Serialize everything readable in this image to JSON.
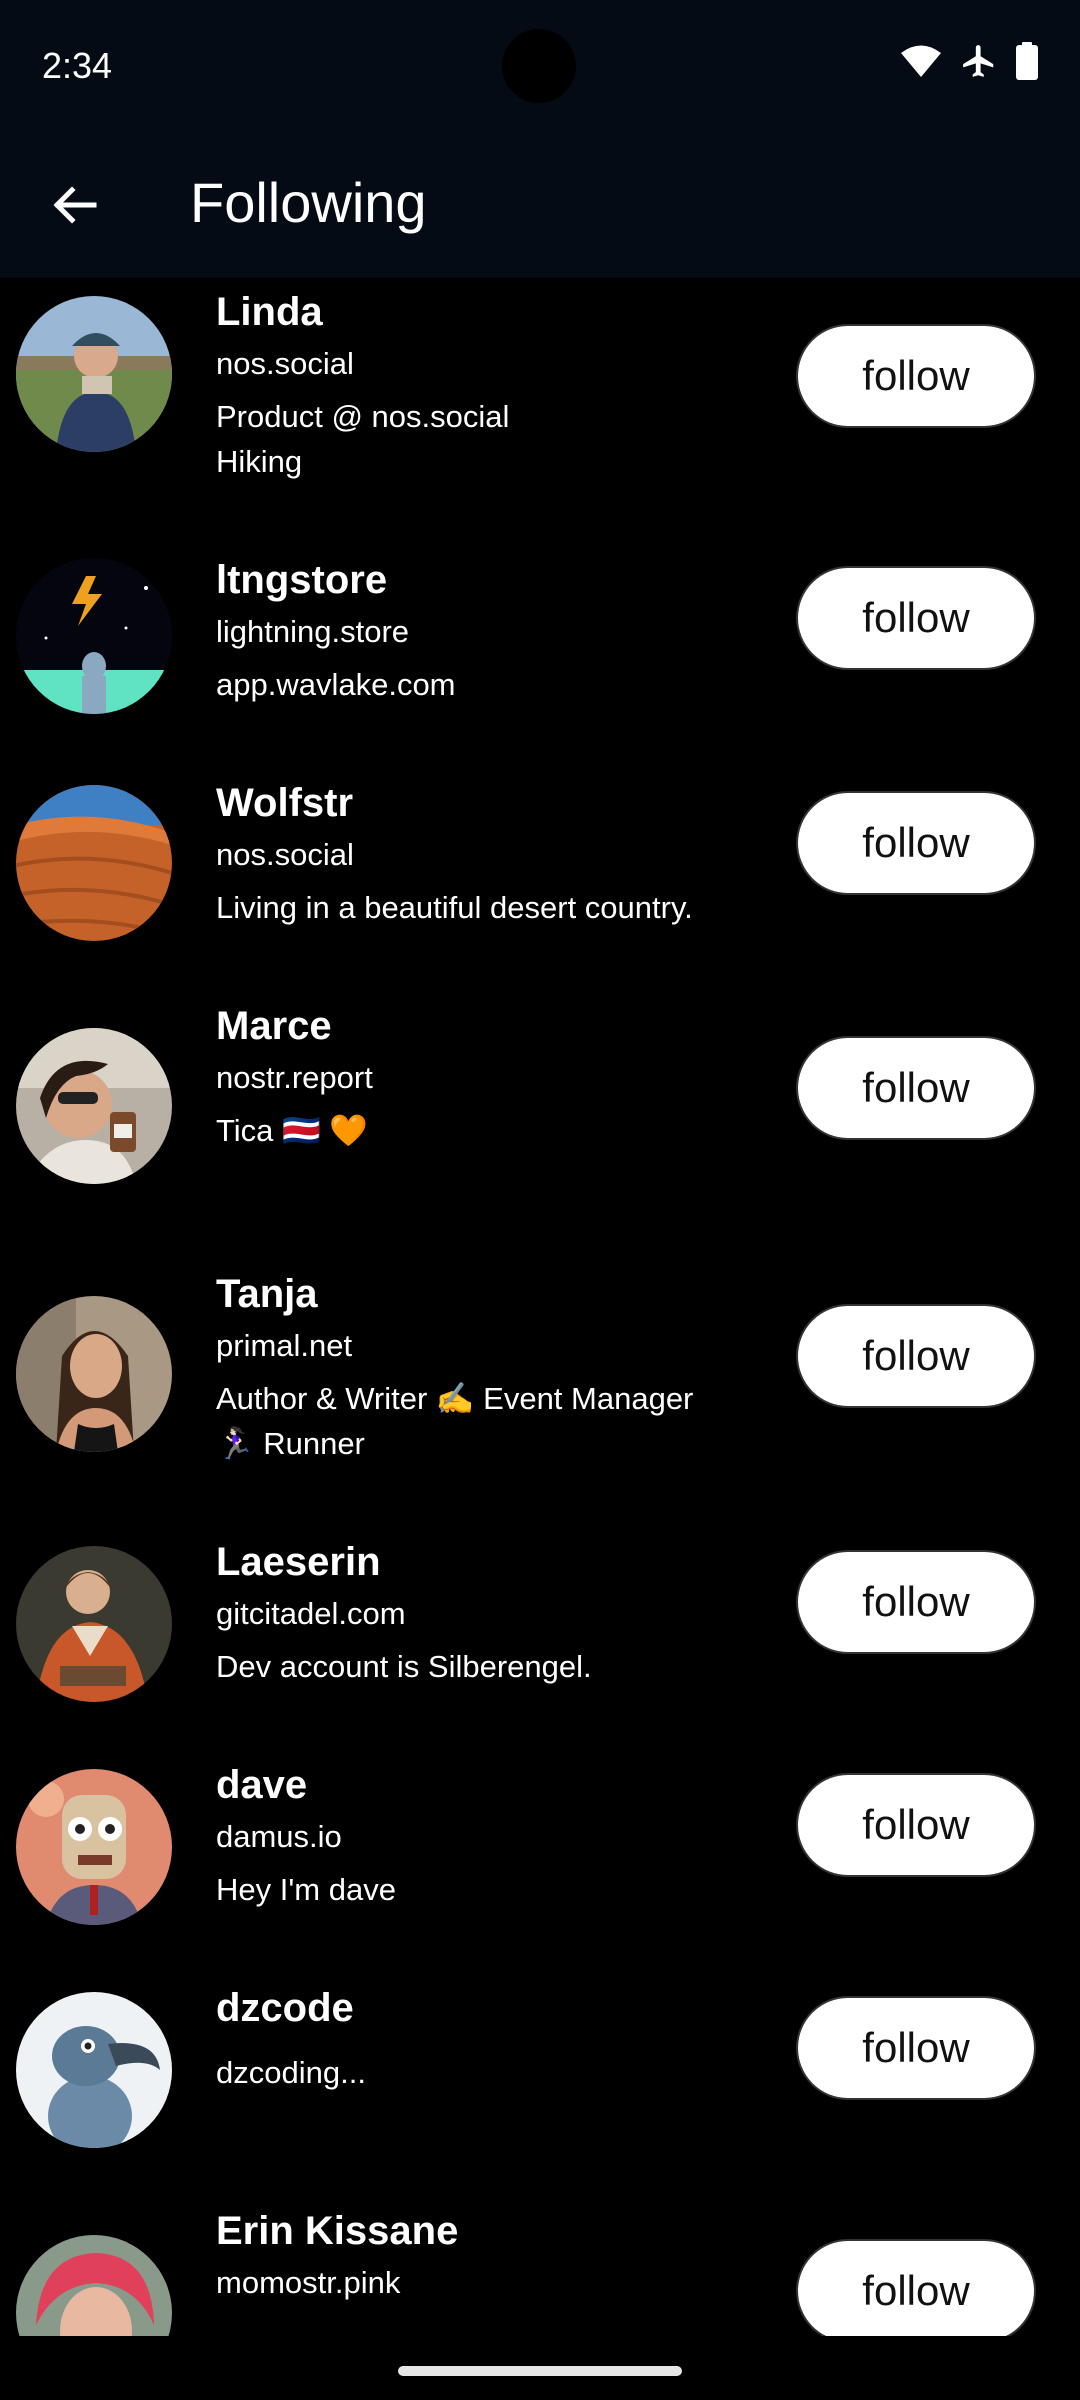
{
  "status_bar": {
    "time": "2:34",
    "icons": [
      "wifi-icon",
      "airplane-icon",
      "battery-icon"
    ]
  },
  "app_bar": {
    "title": "Following",
    "back_icon": "arrow-left-icon"
  },
  "follow_label": "follow",
  "colors": {
    "background": "#000000",
    "header": "#050b14",
    "button_bg": "#ffffff",
    "button_text": "#111111"
  },
  "users": [
    {
      "name": "Linda",
      "nip05": "nos.social",
      "bio": [
        "Product @ nos.social",
        "Hiking"
      ]
    },
    {
      "name": "ltngstore",
      "nip05": "lightning.store",
      "bio": [
        "app.wavlake.com"
      ]
    },
    {
      "name": "Wolfstr",
      "nip05": "nos.social",
      "bio": [
        "Living in a beautiful desert country."
      ]
    },
    {
      "name": "Marce",
      "nip05": "nostr.report",
      "bio": [
        "Tica 🇨🇷 🧡"
      ]
    },
    {
      "name": "Tanja",
      "nip05": "primal.net",
      "bio": [
        "Author & Writer ✍️ Event Manager",
        "🏃🏻‍♀️ Runner"
      ]
    },
    {
      "name": "Laeserin",
      "nip05": "gitcitadel.com",
      "bio": [
        "Dev account is Silberengel."
      ]
    },
    {
      "name": "dave",
      "nip05": "damus.io",
      "bio": [
        "Hey I'm dave"
      ]
    },
    {
      "name": "dzcode",
      "nip05": "",
      "bio": [
        "dzcoding..."
      ]
    },
    {
      "name": "Erin Kissane",
      "nip05": "momostr.pink",
      "bio": []
    }
  ]
}
